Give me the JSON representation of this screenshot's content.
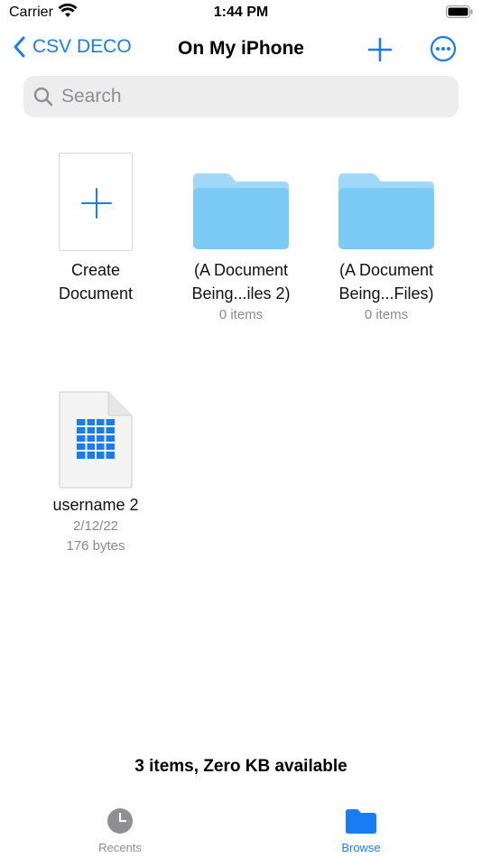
{
  "status_bar": {
    "carrier": "Carrier",
    "time": "1:44 PM"
  },
  "nav": {
    "back_label": "CSV DECO",
    "title": "On My iPhone"
  },
  "search": {
    "placeholder": "Search",
    "value": ""
  },
  "items": [
    {
      "type": "create",
      "label_line1": "Create",
      "label_line2": "Document"
    },
    {
      "type": "folder",
      "label_line1": "(A Document",
      "label_line2": "Being...iles 2)",
      "detail": "0 items"
    },
    {
      "type": "folder",
      "label_line1": "(A Document",
      "label_line2": "Being...Files)",
      "detail": "0 items"
    },
    {
      "type": "file",
      "label_line1": "username 2",
      "date": "2/12/22",
      "size": "176 bytes"
    }
  ],
  "footer": {
    "summary": "3 items, Zero KB available"
  },
  "tabbar": {
    "tabs": [
      {
        "label": "Recents",
        "icon": "clock-icon",
        "selected": false
      },
      {
        "label": "Browse",
        "icon": "folder-icon",
        "selected": true
      }
    ]
  },
  "colors": {
    "accent": "#1a7cf5",
    "folder": "#7ccaf6",
    "folder_tab": "#9fd8f8",
    "secondary_text": "#8a8a8e"
  }
}
